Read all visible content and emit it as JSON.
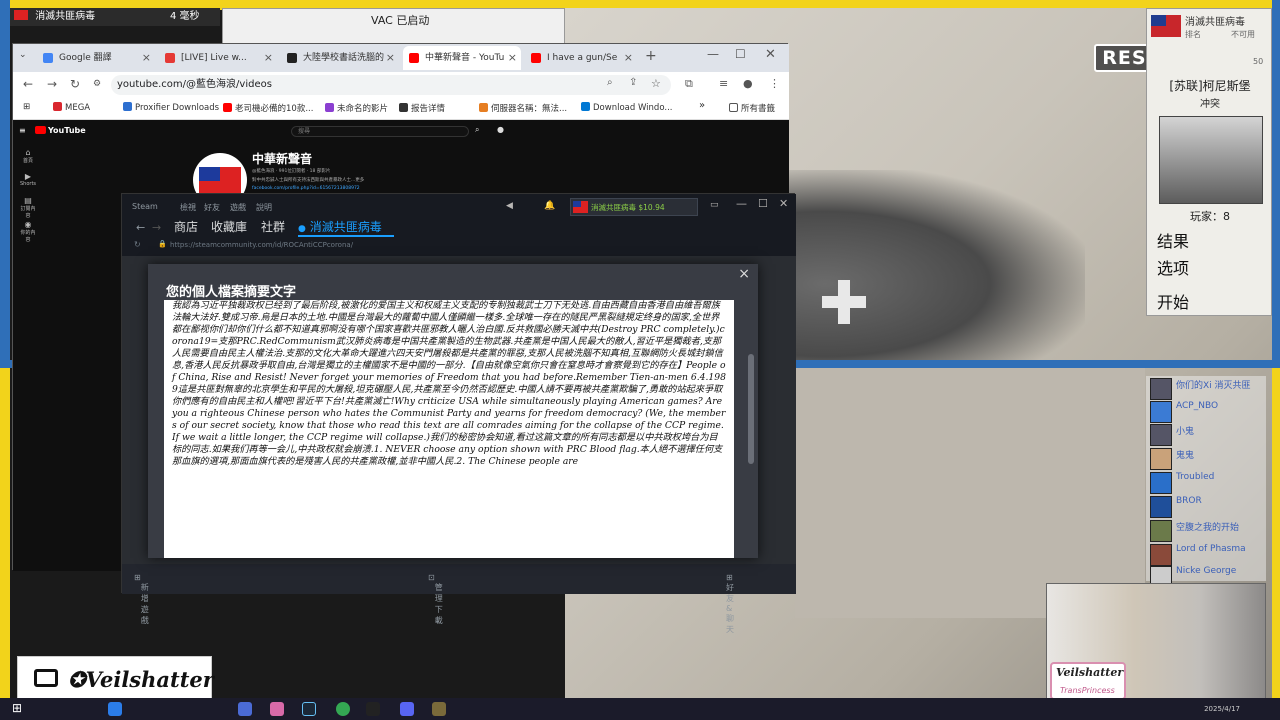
{
  "overlay": {
    "top_strip_title": "消滅共匪病毒",
    "top_strip_timer": "4 毫秒",
    "vac_status": "VAC 已启动",
    "restream_label": "RESTREAM",
    "watermark_name": "Veilshatter",
    "webcam_name": "Veilshatter",
    "webcam_tag": "TransPrincess"
  },
  "game_panel": {
    "player_name": "消滅共匪病毒",
    "label_rank": "排名",
    "rank_value": "不可用",
    "value_50": "50",
    "map_name": "[苏联]柯尼斯堡",
    "mode": "冲突",
    "players": "玩家：8",
    "menu": [
      "结果",
      "选项",
      "开始"
    ]
  },
  "friends": [
    {
      "name": "你们的Xi 消灭共匪"
    },
    {
      "name": "ACP_NBO"
    },
    {
      "name": "小鬼"
    },
    {
      "name": "鬼鬼"
    },
    {
      "name": "Troubled"
    },
    {
      "name": "BROR"
    },
    {
      "name": "空腹之我的开始"
    },
    {
      "name": "Lord of Phasma"
    },
    {
      "name": "Nicke George"
    }
  ],
  "browser": {
    "tabs": [
      {
        "label": "Google 翻譯",
        "color": "#4285f4"
      },
      {
        "label": "[LIVE] Live w...",
        "color": "#e53935"
      },
      {
        "label": "大陸學校書話洗腦的",
        "color": "#222222"
      },
      {
        "label": "中華新聲音 - YouTu",
        "color": "#ff0000"
      },
      {
        "label": "I have a gun/Se",
        "color": "#ff0000"
      }
    ],
    "address": "youtube.com/@藍色海浪/videos",
    "bookmarks": [
      "MEGA",
      "Proxifier Downloads",
      "老司機必備的10款...",
      "未命名的影片",
      "报告详情",
      "伺服器名稱：無法...",
      "Download Windo..."
    ],
    "bookmarks_folder": "所有書籤",
    "more_bookmarks": "»"
  },
  "youtube": {
    "logo": "YouTube",
    "search_placeholder": "搜尋",
    "channel_name": "中華新聲音",
    "channel_meta": "@藍色海浪 · 991位訂閱者 · 18 部影片",
    "channel_desc": "對中共忠誠人士與所有支持法西斯與共產暴政人士...更多",
    "channel_link": "facebook.com/profile.php?id=61567213808972",
    "side_items": [
      "首頁",
      "Shorts",
      "訂閱內容",
      "你的內容"
    ]
  },
  "steam": {
    "menu": [
      "Steam",
      "檢視",
      "好友",
      "遊戲",
      "說明"
    ],
    "nav": [
      "商店",
      "收藏庫",
      "社群",
      "消滅共匪病毒"
    ],
    "url": "https://steamcommunity.com/id/ROCAntiCCPcorona/",
    "username": "消滅共匪病毒",
    "balance": "$10.94",
    "bottom_left": "新增遊戲",
    "bottom_center": "管理下載",
    "bottom_right": "好友 & 聊天"
  },
  "dialog": {
    "title": "您的個人檔案摘要文字",
    "close": "×",
    "text": "我認為习近平独裁政权已经到了最后阶段,被激化的爱国主义和权威主义支配的专制独裁武士刀下无处逃.自由西藏自由香港自由維吾爾族法輪大法好.雙成习帝.烏是日本的土地.中國是台灣最大的蘿蔔中國人僅顯繼一樣多.全球唯一存在的隧民严黑裂縫規定终身的国家,全世界都在鄙视你们却你们什么都不知道真邪啊没有哪个国家喜歡共匪邪教人曬人治白國.反共救國必勝天滅中共(Destroy PRC completely.)corona19=支那PRC.RedCommunism武汉肺炎病毒是中国共產黨製造的生物武器.共產黨是中国人民最大的敵人,習近平是獨裁者,支那人民需要自由民主人權法治.支那的文化大革命大躍進六四天安門屠殺都是共產黨的罪惡,支那人民被洗腦不知真相,互聯網防火長城封鎖信息,香港人民反抗暴政爭取自由,台灣是獨立的主權國家不是中國的一部分.【自由就像空氣你只會在窒息時才會察覺到它的存在】People of China, Rise and Resist! Never forget your memories of Freedom that you had before.Remember Tien-an-men 6.4.1989這是共匪對無辜的北京學生和平民的大屠殺,坦克碾壓人民,共產黨至今仍然否認歷史.中國人請不要再被共產黨欺騙了,勇敢的站起來爭取你們應有的自由民主和人權吧!習近平下台!共產黨滅亡!Why criticize USA while simultaneously playing American games? Are you a righteous Chinese person who hates the Communist Party and yearns for freedom democracy? (We, the members of our secret society, know that those who read this text are all comrades aiming for the collapse of the CCP regime. If we wait a little longer, the CCP regime will collapse.)我们的秘密协会知道,看过这篇文章的所有同志都是以中共政权垮台为目标的同志.如果我们再等一会儿,中共政权就会崩溃.1. NEVER choose any option shown with PRC Blood flag.本人絕不選擇任何支那血旗的選項,那面血旗代表的是殘害人民的共產黨政權,並非中國人民.2. The Chinese people are"
  },
  "taskbar": {
    "time": "2025/4/17"
  }
}
